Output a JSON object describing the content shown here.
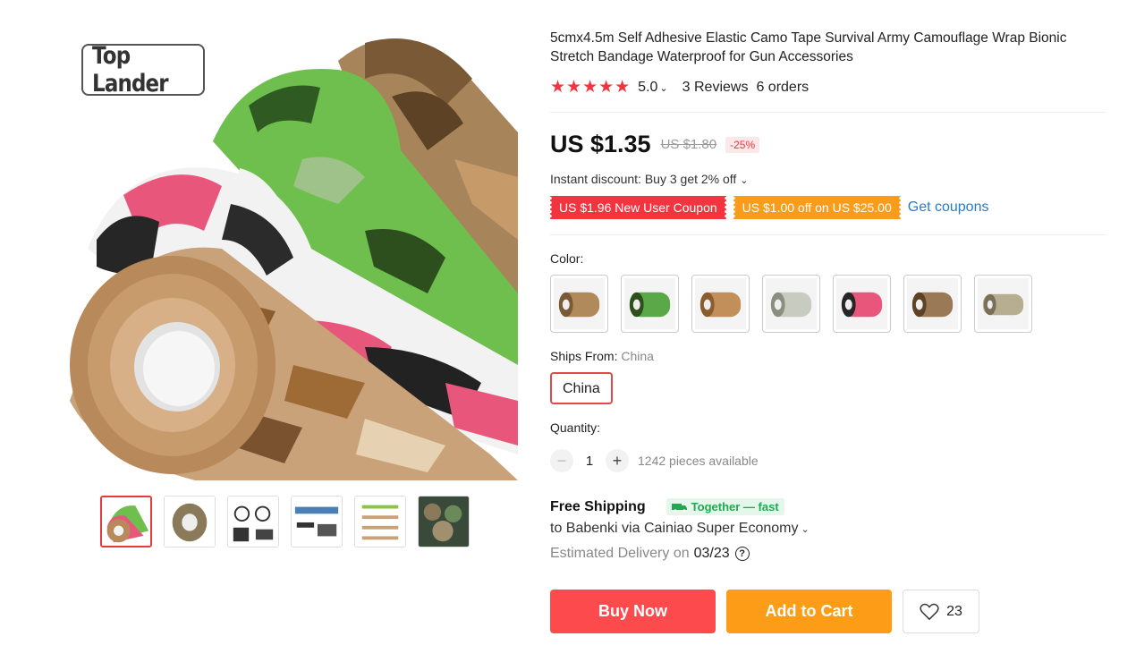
{
  "product": {
    "title": "5cmx4.5m Self Adhesive Elastic Camo Tape Survival Army Camouflage Wrap Bionic Stretch Bandage Waterproof for Gun Accessories",
    "brand_logo": "Top Lander",
    "main_image_icon": "camo-tape-rolls-image"
  },
  "rating": {
    "stars": "★★★★★",
    "value": "5.0",
    "reviews": "3 Reviews",
    "orders": "6 orders"
  },
  "price": {
    "current": "US $1.35",
    "original": "US $1.80",
    "discount": "-25%"
  },
  "discounts": {
    "instant": "Instant discount: Buy 3 get 2% off",
    "coupon_new_user": "US $1.96 New User Coupon",
    "coupon_store": "US $1.00 off on US $25.00",
    "get_coupons": "Get coupons"
  },
  "color": {
    "label": "Color:",
    "options": [
      "tan",
      "green",
      "brown",
      "white",
      "pink",
      "desert",
      "digital"
    ]
  },
  "ships_from": {
    "label": "Ships From:",
    "value": "China",
    "option": "China"
  },
  "quantity": {
    "label": "Quantity:",
    "value": "1",
    "minus": "−",
    "plus": "+",
    "available": "1242 pieces available"
  },
  "shipping": {
    "title": "Free Shipping",
    "badge": "Together — fast",
    "via": "to Babenki via Cainiao Super Economy",
    "estimate_label": "Estimated Delivery on",
    "estimate_date": "03/23",
    "help": "?"
  },
  "actions": {
    "buy_now": "Buy Now",
    "add_to_cart": "Add to Cart",
    "wishlist_count": "23"
  },
  "colors": {
    "accent_red": "#fd4a4d",
    "accent_orange": "#fd9c16",
    "link_blue": "#2a7bc6",
    "green_badge": "#1dab52"
  }
}
